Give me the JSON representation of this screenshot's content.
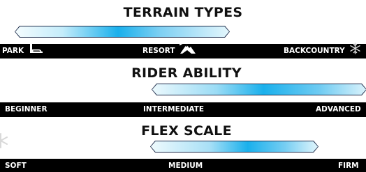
{
  "colors": {
    "band": "#000000",
    "bar_outline": "#1d2b4a",
    "bar_fill_light": "#e7f7fc",
    "bar_fill_accent": "#1ab0ec"
  },
  "sections": [
    {
      "title": "TERRAIN TYPES",
      "labels": [
        "PARK",
        "RESORT",
        "BACKCOUNTRY"
      ],
      "icons": [
        "park-icon",
        "resort-icon",
        "backcountry-snowflake-icon"
      ]
    },
    {
      "title": "RIDER  ABILITY",
      "labels": [
        "BEGINNER",
        "INTERMEDIATE",
        "ADVANCED"
      ]
    },
    {
      "title": "FLEX SCALE",
      "labels": [
        "SOFT",
        "MEDIUM",
        "FIRM"
      ]
    }
  ]
}
